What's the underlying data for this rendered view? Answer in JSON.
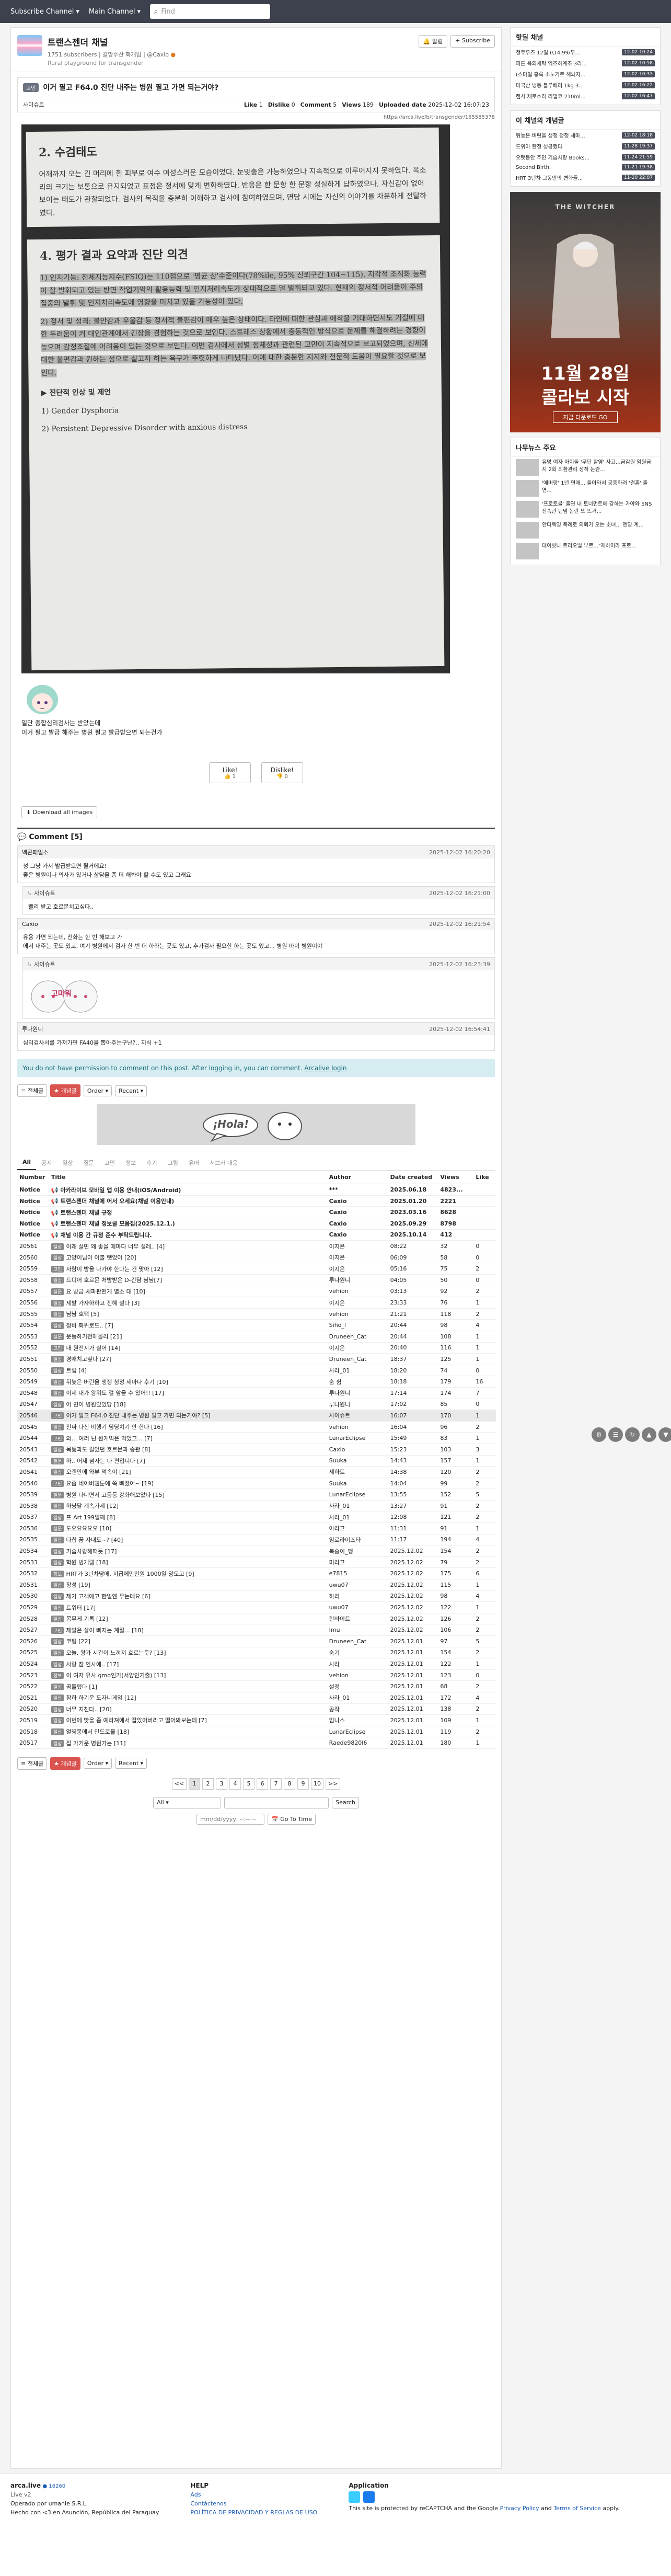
{
  "topbar": {
    "subscribe_channel": "Subscribe Channel",
    "main_channel": "Main Channel",
    "find_placeholder": "Find"
  },
  "channel": {
    "title": "트랜스젠더 채널",
    "subscribers": "1751 subscribers",
    "owner": "갈망수산 화개빔",
    "manager": "@Caxio",
    "desc": "Rural playground for transgender",
    "btn_alert": "알림",
    "btn_subscribe": "+ Subscribe"
  },
  "post": {
    "category": "고민",
    "title": "이거 필고 F64.0 진단 내주는 병원 필고 가면 되는거야?",
    "author": "사이슈트",
    "like_label": "Like",
    "like_count": "1",
    "dislike_label": "Dislike",
    "dislike_count": "0",
    "comment_label": "Comment",
    "comment_count": "5",
    "views_label": "Views",
    "views_count": "189",
    "uploaded_label": "Uploaded date",
    "uploaded_date": "2025-12-02 16:07:23",
    "source_link": "https://arca.live/b/transgender/155585378",
    "caption_1": "일단 종합심리검사는 받았는데",
    "caption_2": "이거 필고 발급 해주는 병원 필고 발급받으면 되는건가",
    "vote_like": "Like!",
    "vote_like_sub": "1",
    "vote_dislike": "Dislike!",
    "vote_dislike_sub": "0",
    "download_all": "Download all images"
  },
  "doc": {
    "h1": "2. 수검태도",
    "p1": "어깨까지 오는 긴 머리에 흰 피부로 여수 여성스러운 모습이었다. 눈맞춤은 가능하였으나 지속적으로 이루어지지 못하였다. 목소리의 크기는 보통으로 유지되었고 표정은 정서에 맞게 변화하였다. 반응은 한 문항 한 문항 성실하게 답하였으나, 자신감이 없어 보이는 태도가 관찰되었다. 검사의 목적을 충분히 이해하고 검사에 참여하였으며, 면담 시에는 자신의 이야기를 차분하게 전달하였다.",
    "h2": "4. 평가 결과 요약과 진단 의견",
    "p2": "1) 인지기능: 전체지능지수(FSIQ)는 110점으로 '평균 상'수준이다(78%ile, 95% 신뢰구간 104~115). 지각적 조직화 능력이 잘 발휘되고 있는 반면 작업기억의 활용능력 및 인지처리속도가 상대적으로 덜 발휘되고 있다. 현재의 정서적 어려움이 주의집중의 발휘 및 인지처리속도에 영향을 미치고 있을 가능성이 있다.",
    "p3": "2) 정서 및 성격: 불안감과 우울감 등 정서적 불편감이 매우 높은 상태이다. 타인에 대한 관심과 애착을 기대하면서도 거절에 대한 두려움이 커 대인관계에서 긴장을 경험하는 것으로 보인다. 스트레스 상황에서 충동적인 방식으로 문제를 해결하려는 경향이 높으며 감정조절에 어려움이 있는 것으로 보인다. 이번 검사에서 성별 정체성과 관련된 고민이 지속적으로 보고되었으며, 신체에 대한 불편감과 원하는 성으로 살고자 하는 욕구가 뚜렷하게 나타났다. 이에 대한 충분한 지지와 전문적 도움이 필요할 것으로 보인다.",
    "p4": "▶ 진단적 인상 및 제언",
    "p5": "1) Gender Dysphoria",
    "p6": "2) Persistent Depressive Disorder with anxious distress"
  },
  "comments": {
    "title": "Comment",
    "count": "[5]",
    "items": [
      {
        "author": "벡콘패일소",
        "time": "2025-12-02 16:20:20",
        "text": "성 그냥 가서 발급받으면 될거에요!\n좋은 병원이나 의사가 있거나 상담을 좀 더 해봐야 할 수도 있고 그래요",
        "reply": false
      },
      {
        "author": "사이슈트",
        "time": "2025-12-02 16:21:00",
        "text": "빨리 받고 호르몬치고싶다..",
        "reply": true
      },
      {
        "author": "Caxio",
        "time": "2025-12-02 16:21:54",
        "text": "유용 가면 되는데, 전화는 한 번 해보고 가\n에서 내주는 곳도 있고, 여기 병원에서 검사 한 번 더 하라는 곳도 있고, 추가검사 필요한 하는 곳도 있고... 병원 바이 병원이야",
        "reply": false
      },
      {
        "author": "사이슈트",
        "time": "2025-12-02 16:23:39",
        "text": "",
        "reply": true,
        "emoji_text": "고마워"
      },
      {
        "author": "루나원니",
        "time": "2025-12-02 16:54:41",
        "text": "심리검사서를 가져가면 FA40을 뽑아주는구난?.. 지식 +1",
        "reply": false
      }
    ]
  },
  "no_permission": {
    "text": "You do not have permission to comment on this post. After logging in, you can comment.",
    "link": "Arcalive login"
  },
  "list_controls": {
    "all": "전체글",
    "best": "개념글",
    "order": "Order",
    "recent": "Recent"
  },
  "banner": {
    "text": "¡Hola!"
  },
  "tabs": [
    "All",
    "공지",
    "일상",
    "질문",
    "고민",
    "정보",
    "후기",
    "그림",
    "유머",
    "서브카 대응"
  ],
  "table": {
    "headers": [
      "Number",
      "Title",
      "Author",
      "Date created",
      "Views",
      "Like"
    ],
    "notices": [
      {
        "num": "Notice",
        "title": "아카라이브 모바일 앱 이용 안내(iOS/Android)",
        "author": "***",
        "date": "2025.06.18",
        "views": "4823...",
        "like": ""
      },
      {
        "num": "Notice",
        "title": "트랜스젠더 채널에 어서 오세요(채널 이용안내)",
        "author": "Caxio",
        "date": "2025.01.20",
        "views": "2221",
        "like": ""
      },
      {
        "num": "Notice",
        "title": "트랜스젠더 채널 규정",
        "author": "Caxio",
        "date": "2023.03.16",
        "views": "8628",
        "like": ""
      },
      {
        "num": "Notice",
        "title": "트랜스젠더 채널 정보글 모음집(2025.12.1.)",
        "author": "Caxio",
        "date": "2025.09.29",
        "views": "8798",
        "like": ""
      },
      {
        "num": "Notice",
        "title": "채널 이용 간 규정 준수 부탁드립니다.",
        "author": "Caxio",
        "date": "2025.10.14",
        "views": "412",
        "like": ""
      }
    ],
    "rows": [
      {
        "num": "20561",
        "cat": "일상",
        "title": "이래 살면 왜 좋을 때마다 너무 설레.. [4]",
        "author": "이지은",
        "date": "08:22",
        "views": "32",
        "like": "0"
      },
      {
        "num": "20560",
        "cat": "일상",
        "title": "고양이님이 이불 뺏었어 [20]",
        "author": "이지은",
        "date": "06:09",
        "views": "58",
        "like": "0"
      },
      {
        "num": "20559",
        "cat": "고민",
        "title": "사람이 방을 나가야 한다는 건 맞아 [12]",
        "author": "이지은",
        "date": "05:16",
        "views": "75",
        "like": "2"
      },
      {
        "num": "20558",
        "cat": "일상",
        "title": "드디어 호르몬 처방받은 D-긴담 냠냠[7]",
        "author": "루나원니",
        "date": "04:05",
        "views": "50",
        "like": "0"
      },
      {
        "num": "20557",
        "cat": "질문",
        "title": "요 방금 새파판떤게 별소 대 [10]",
        "author": "vehion",
        "date": "03:13",
        "views": "92",
        "like": "2"
      },
      {
        "num": "20556",
        "cat": "일상",
        "title": "제발 가자하하고 진혜 설다 [3]",
        "author": "이지은",
        "date": "23:33",
        "views": "76",
        "like": "1"
      },
      {
        "num": "20555",
        "cat": "일상",
        "title": "냠냠 호팩 [5]",
        "author": "vehion",
        "date": "21:21",
        "views": "118",
        "like": "2"
      },
      {
        "num": "20554",
        "cat": "일상",
        "title": "정바 화위로드.. [7]",
        "author": "Siho_l",
        "date": "20:44",
        "views": "98",
        "like": "4"
      },
      {
        "num": "20553",
        "cat": "질문",
        "title": "운동하기전에올리 [21]",
        "author": "Druneen_Cat",
        "date": "20:44",
        "views": "108",
        "like": "1"
      },
      {
        "num": "20552",
        "cat": "고민",
        "title": "내 뭔전지가 실어 [14]",
        "author": "이지은",
        "date": "20:40",
        "views": "116",
        "like": "1"
      },
      {
        "num": "20551",
        "cat": "일상",
        "title": "경매치고싶다 [27]",
        "author": "Druneen_Cat",
        "date": "18:37",
        "views": "125",
        "like": "1"
      },
      {
        "num": "20550",
        "cat": "일상",
        "title": "트립 [4]",
        "author": "사라_01",
        "date": "18:20",
        "views": "74",
        "like": "0"
      },
      {
        "num": "20549",
        "cat": "일상",
        "title": "뒤늦은 버린을 생쟁 청정 세마나 후기 [10]",
        "author": "숨 쉼",
        "date": "18:18",
        "views": "179",
        "like": "16"
      },
      {
        "num": "20548",
        "cat": "일상",
        "title": "이제 내가 왕위도 걸 앞을 수 있어!! [17]",
        "author": "루나원니",
        "date": "17:14",
        "views": "174",
        "like": "7"
      },
      {
        "num": "20547",
        "cat": "일상",
        "title": "어 면이 병원있었당 [18]",
        "author": "루나원니",
        "date": "17:02",
        "views": "85",
        "like": "0"
      },
      {
        "num": "20546",
        "cat": "고민",
        "title": "이거 필고 F64.0 진단 내주는 병원 필고 가면 되는거야? [5]",
        "author": "사이슈트",
        "date": "16:07",
        "views": "170",
        "like": "1",
        "current": true
      },
      {
        "num": "20545",
        "cat": "일상",
        "title": "진짜 다신 비행기 딩딩치기 안 한다 [16]",
        "author": "vehion",
        "date": "16:04",
        "views": "96",
        "like": "2"
      },
      {
        "num": "20544",
        "cat": "고민",
        "title": "와... 여러 넌 뭔게믹은 먹었고... [7]",
        "author": "LunarEclipse",
        "date": "15:49",
        "views": "83",
        "like": "1"
      },
      {
        "num": "20543",
        "cat": "일상",
        "title": "목통과도 걸었던 호르몬과 중관 [8]",
        "author": "Caxio",
        "date": "15:23",
        "views": "103",
        "like": "3"
      },
      {
        "num": "20542",
        "cat": "질문",
        "title": "하.. 어제 넘자는 다 편입니다 [7]",
        "author": "Suuka",
        "date": "14:43",
        "views": "157",
        "like": "1"
      },
      {
        "num": "20541",
        "cat": "일상",
        "title": "오랜만에 와뷰 먹속이 [21]",
        "author": "세하트",
        "date": "14:38",
        "views": "120",
        "like": "2"
      },
      {
        "num": "20540",
        "cat": "고민",
        "title": "요즘 네이버웹툰에 쪽 빠졌어~ [19]",
        "author": "Suuka",
        "date": "14:04",
        "views": "99",
        "like": "2"
      },
      {
        "num": "20539",
        "cat": "질문",
        "title": "병원 다니면서 고등등 강화해보았다 [15]",
        "author": "LunarEclipse",
        "date": "13:55",
        "views": "152",
        "like": "5"
      },
      {
        "num": "20538",
        "cat": "일상",
        "title": "하냥달 계속가세 [12]",
        "author": "사라_01",
        "date": "13:27",
        "views": "91",
        "like": "2"
      },
      {
        "num": "20537",
        "cat": "일상",
        "title": "프 Art 199일째 [8]",
        "author": "사라_01",
        "date": "12:08",
        "views": "121",
        "like": "2"
      },
      {
        "num": "20536",
        "cat": "질문",
        "title": "도요요요요오 [10]",
        "author": "아라고",
        "date": "11:31",
        "views": "91",
        "like": "1"
      },
      {
        "num": "20535",
        "cat": "일상",
        "title": "다칩 꿈 자내도~? [40]",
        "author": "임로라이즈타",
        "date": "11:17",
        "views": "194",
        "like": "4"
      },
      {
        "num": "20534",
        "cat": "일상",
        "title": "기습사랑해떠듯 [17]",
        "author": "복숭이_맹",
        "date": "2025.12.02",
        "views": "154",
        "like": "2"
      },
      {
        "num": "20533",
        "cat": "일상",
        "title": "학원 벙개렐 [18]",
        "author": "미라고",
        "date": "2025.12.02",
        "views": "79",
        "like": "2"
      },
      {
        "num": "20532",
        "cat": "정보",
        "title": "HRT가 3년차땅에, 지급에만만원 1000일 양도고 [9]",
        "author": "e7815",
        "date": "2025.12.02",
        "views": "175",
        "like": "6"
      },
      {
        "num": "20531",
        "cat": "일상",
        "title": "장성 [19]",
        "author": "uwu07",
        "date": "2025.12.02",
        "views": "115",
        "like": "1"
      },
      {
        "num": "20530",
        "cat": "일상",
        "title": "제가 고객에고 한일엔 무는데요 [6]",
        "author": "하리",
        "date": "2025.12.02",
        "views": "98",
        "like": "4"
      },
      {
        "num": "20529",
        "cat": "일상",
        "title": "트위터 [17]",
        "author": "uwu07",
        "date": "2025.12.02",
        "views": "122",
        "like": "1"
      },
      {
        "num": "20528",
        "cat": "일상",
        "title": "몸무게 기록 [12]",
        "author": "한바이트",
        "date": "2025.12.02",
        "views": "126",
        "like": "2"
      },
      {
        "num": "20527",
        "cat": "고민",
        "title": "제발은 살이 빠지는 계절... [18]",
        "author": "Imu",
        "date": "2025.12.02",
        "views": "106",
        "like": "2"
      },
      {
        "num": "20526",
        "cat": "일상",
        "title": "코팅 [22]",
        "author": "Druneen_Cat",
        "date": "2025.12.01",
        "views": "97",
        "like": "5"
      },
      {
        "num": "20525",
        "cat": "일상",
        "title": "오늘, 왕가 시간이 느껴져 흐르는듯? [13]",
        "author": "숨기",
        "date": "2025.12.01",
        "views": "154",
        "like": "2"
      },
      {
        "num": "20524",
        "cat": "일상",
        "title": "사랑 참 인사에.. [17]",
        "author": "사라",
        "date": "2025.12.01",
        "views": "122",
        "like": "1"
      },
      {
        "num": "20523",
        "cat": "정보",
        "title": "이 여자 유사 gmo인가(서양인기출) [13]",
        "author": "vehion",
        "date": "2025.12.01",
        "views": "123",
        "like": "0"
      },
      {
        "num": "20522",
        "cat": "일상",
        "title": "곰돌렸다 [1]",
        "author": "설정",
        "date": "2025.12.01",
        "views": "68",
        "like": "2"
      },
      {
        "num": "20521",
        "cat": "일상",
        "title": "잠하 하기운 도자니게임 [12]",
        "author": "사라_01",
        "date": "2025.12.01",
        "views": "172",
        "like": "4"
      },
      {
        "num": "20520",
        "cat": "일상",
        "title": "너무 지친다.. [20]",
        "author": "공작",
        "date": "2025.12.01",
        "views": "138",
        "like": "2"
      },
      {
        "num": "20519",
        "cat": "일상",
        "title": "이번에 맛을 좀 예라져에서 잡았어버리고 떨어봐보는데 [7]",
        "author": "임나스",
        "date": "2025.12.01",
        "views": "109",
        "like": "1"
      },
      {
        "num": "20518",
        "cat": "일상",
        "title": "얼띵몽에서 만드로물 [18]",
        "author": "LunarEclipse",
        "date": "2025.12.01",
        "views": "119",
        "like": "2"
      },
      {
        "num": "20517",
        "cat": "일상",
        "title": "접 가거운 병원가는 [11]",
        "author": "Raede9820l6",
        "date": "2025.12.01",
        "views": "180",
        "like": "1"
      }
    ]
  },
  "pager": {
    "pages": [
      "<<",
      "1",
      "2",
      "3",
      "4",
      "5",
      "6",
      "7",
      "8",
      "9",
      "10",
      ">>"
    ],
    "active": "1",
    "search_scope": "All",
    "search_btn": "Search",
    "date_placeholder": "mm/dd/yyyy, --:-- --",
    "goto_btn": "Go To Time"
  },
  "side": {
    "hot_title": "핫딜 채널",
    "hot_items": [
      {
        "t": "청쭈우즈 12일 (\\14,99/무...",
        "b": "12-02 10:24"
      },
      {
        "t": "퍼튼 옥외세탁 역즈하계조 3리...",
        "b": "12-02 10:58"
      },
      {
        "t": "(스마일 홍록 소노기르 해뇌자...",
        "b": "12-02 10:33"
      },
      {
        "t": "마국산 냉동 블루베리 1kg 3...",
        "b": "12-02 16:22"
      },
      {
        "t": "캠시 제로소라 리얼코 210ml...",
        "b": "12-02 16:47"
      }
    ],
    "concept_title": "이 채널의 개념글",
    "concept_items": [
      {
        "t": "뒤늦은 버린을 생쟁 청정 세마...",
        "b": "12-02 18:18"
      },
      {
        "t": "드위아 한정 성공했다",
        "b": "11-28 19:37"
      },
      {
        "t": "오랫동안 주인 기습사랑 Books...",
        "b": "11-24 21:59"
      },
      {
        "t": "Second Birth.",
        "b": "11-21 19:38"
      },
      {
        "t": "HRT 3년차 그동안의 변화들...",
        "b": "11-20 22:07"
      }
    ],
    "ad_game": "THE WITCHER",
    "ad_date": "11월 28일",
    "ad_sub": "콜라보 시작",
    "ad_btn": "지금 다운로드 GO",
    "news_title": "나무뉴스 주요",
    "news_items": [
      "유명 여자 아이돌 '무단 촬영' 사고...금감원 임원금지 2회 외환관리 성적 논란...",
      "'에버랑' 1년 연애... 돌아와서 공중화려 '결혼' 출연...",
      "'프로토콜' 출연 내 토너먼트에 강하는 가야와 SNS 전속관 팬덤 논란 또 뜨거...",
      "안다렉잉 폭례로 의뢰가 오는 소녀... 엔딩 계...",
      "데이빗나 트리오벌 부르...\"제하이라 프로..."
    ]
  },
  "footer": {
    "brand": "arca.live",
    "count": "16260",
    "version": "Live v2",
    "operator": "Operado por umanle S.R.L.",
    "address": "Hecho con <3 en Asunción, República del Paraguay",
    "help_title": "HELP",
    "help_1": "Ads",
    "help_2": "Contáctenos",
    "help_3": "POLÍTICA DE PRIVACIDAD Y REGLAS DE USO",
    "app_title": "Application",
    "recaptcha": "This site is protected by reCAPTCHA and the Google",
    "privacy": "Privacy Policy",
    "and": "and",
    "terms": "Terms of Service",
    "apply": "apply."
  }
}
